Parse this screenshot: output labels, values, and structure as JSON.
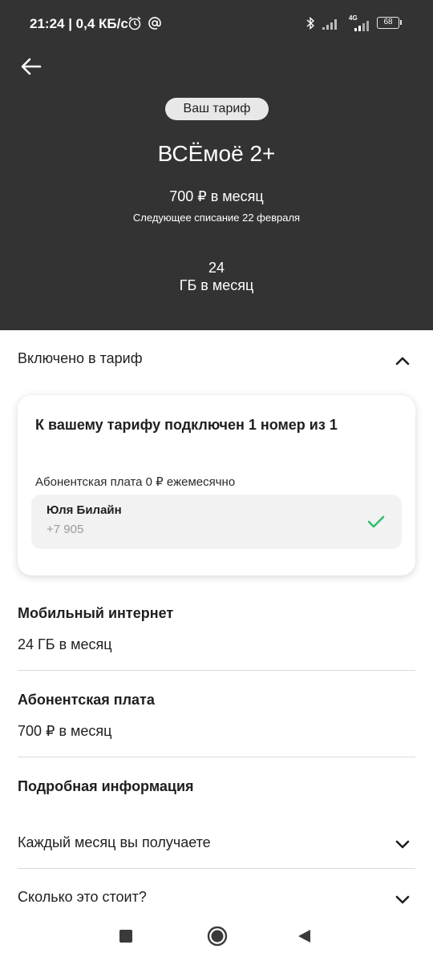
{
  "status_bar": {
    "time_speed": "21:24 | 0,4 КБ/с",
    "network_label": "4G",
    "battery": "68",
    "icons": [
      "alarm-icon",
      "at-sign-icon",
      "bluetooth-icon",
      "signal-icon",
      "signal-4g-icon",
      "battery-icon"
    ]
  },
  "header": {
    "badge": "Ваш тариф",
    "tariff_name": "ВСЁмоё 2+",
    "price": "700 ₽ в месяц",
    "next_charge": "Следующее списание 22 февраля",
    "gb_value": "24",
    "gb_unit": "ГБ в месяц",
    "back_icon": "arrow-left-icon"
  },
  "included": {
    "title": "Включено в тариф",
    "toggle_icon": "chevron-up-icon",
    "card": {
      "title": "К вашему тарифу подключен 1 номер из 1",
      "fee": "Абонентская плата 0 ₽ ежемесячно",
      "member": {
        "name": "Юля Билайн",
        "phone": "+7 905",
        "status_icon": "check-icon"
      }
    }
  },
  "internet": {
    "title": "Мобильный интернет",
    "value": "24 ГБ в месяц"
  },
  "fee": {
    "title": "Абонентская плата",
    "value": "700 ₽ в месяц"
  },
  "details": {
    "title": "Подробная информация",
    "items": [
      {
        "label": "Каждый месяц вы получаете",
        "icon": "chevron-down-icon"
      },
      {
        "label": "Сколько это стоит?",
        "icon": "chevron-down-icon"
      }
    ]
  },
  "nav": {
    "icons": [
      "recent-apps-icon",
      "home-icon",
      "back-triangle-icon"
    ]
  },
  "colors": {
    "header_bg": "#333333",
    "accent_check": "#2fbf71"
  }
}
